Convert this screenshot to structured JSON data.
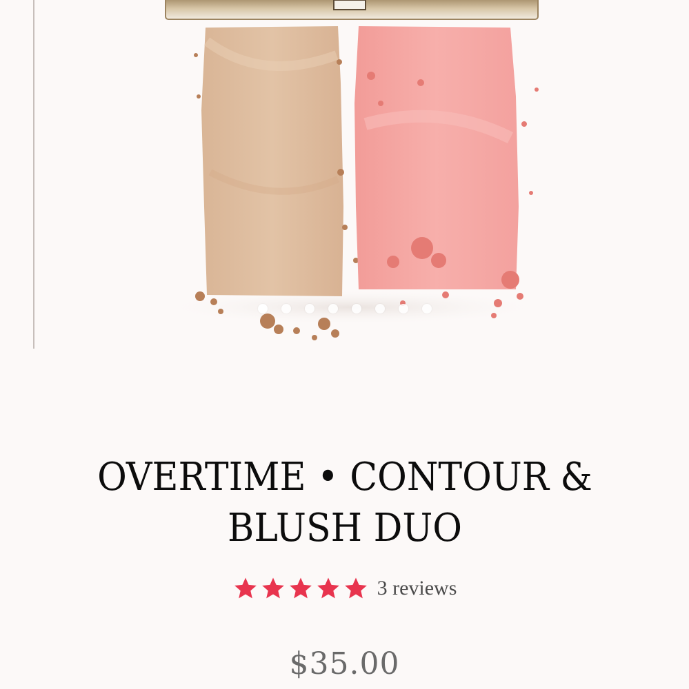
{
  "product": {
    "title": "OVERTIME • CONTOUR & BLUSH DUO",
    "rating": {
      "stars": 5,
      "max_stars": 5,
      "reviews_text": "3 reviews",
      "star_color": "#e8344e"
    },
    "price": "$35.00"
  },
  "gallery": {
    "image_icon": "product-swatch-image",
    "slide_count": 8,
    "active_slide": 1,
    "swatch_colors": {
      "contour": "#ddbb9d",
      "blush": "#f4a3a1",
      "compact": "#b99a6b"
    }
  }
}
